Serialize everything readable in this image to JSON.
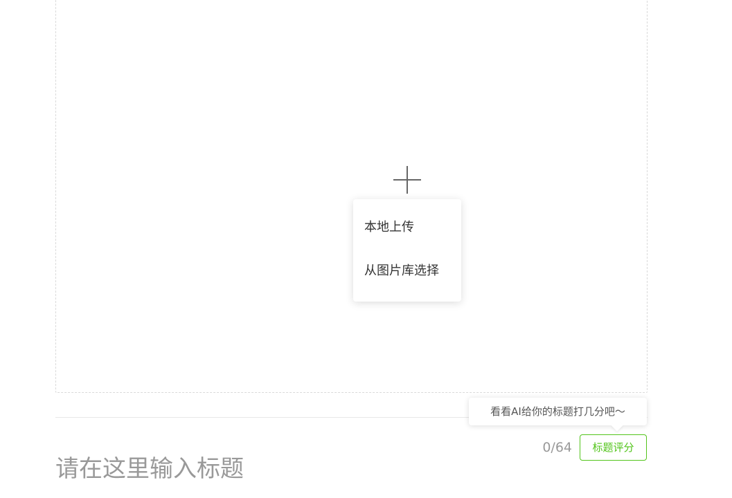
{
  "upload": {
    "icon": "plus-icon",
    "menu_items": [
      {
        "label": "本地上传"
      },
      {
        "label": "从图片库选择"
      }
    ]
  },
  "title_section": {
    "tooltip": "看看AI给你的标题打几分吧～",
    "counter": "0/64",
    "score_button": "标题评分",
    "title_placeholder": "请在这里输入标题",
    "title_value": ""
  },
  "colors": {
    "accent": "#52c41a",
    "border_dashed": "#d9d9d9",
    "placeholder": "#999999"
  }
}
